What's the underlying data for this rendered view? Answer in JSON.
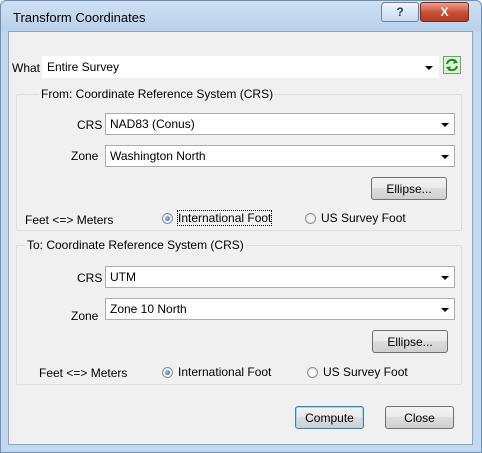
{
  "window": {
    "title": "Transform Coordinates"
  },
  "titlebar": {
    "help_label": "?",
    "close_label": "X"
  },
  "what": {
    "label": "What",
    "value": "Entire Survey"
  },
  "from": {
    "group_title": "From: Coordinate Reference System (CRS)",
    "crs_label": "CRS",
    "crs_value": "NAD83 (Conus)",
    "zone_label": "Zone",
    "zone_value": "Washington North",
    "ellipse_label": "Ellipse...",
    "units_label": "Feet <=> Meters",
    "opt_international": "International Foot",
    "opt_us": "US Survey Foot",
    "selected": "International Foot"
  },
  "to": {
    "group_title": "To: Coordinate Reference System (CRS)",
    "crs_label": "CRS",
    "crs_value": "UTM",
    "zone_label": "Zone",
    "zone_value": "Zone 10 North",
    "ellipse_label": "Ellipse...",
    "units_label": "Feet <=> Meters",
    "opt_international": "International Foot",
    "opt_us": "US Survey Foot",
    "selected": "International Foot"
  },
  "footer": {
    "compute_label": "Compute",
    "close_label": "Close"
  },
  "icons": {
    "refresh": "refresh-icon",
    "dropdown": "chevron-down-icon"
  }
}
